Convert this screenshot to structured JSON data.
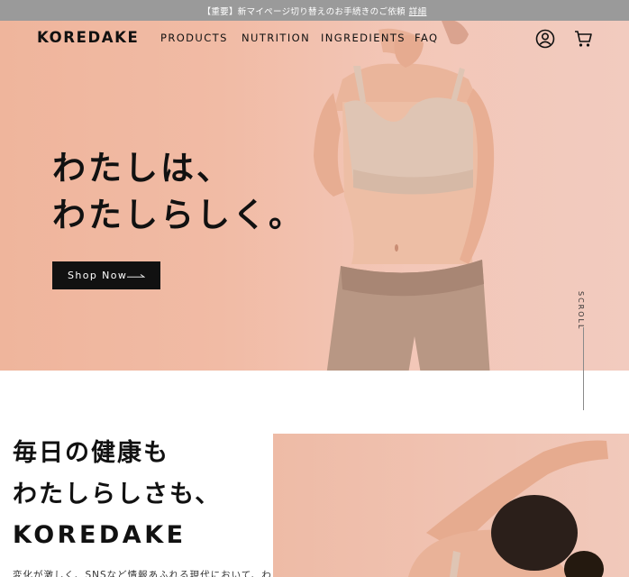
{
  "announcement": {
    "text": "【重要】新マイページ切り替えのお手続きのご依頼",
    "link": "詳細"
  },
  "header": {
    "logo": "KOREDAKE",
    "nav": [
      "PRODUCTS",
      "NUTRITION",
      "INGREDIENTS",
      "FAQ"
    ],
    "icons": [
      "account-icon",
      "cart-icon"
    ]
  },
  "hero": {
    "headline_line1": "わたしは、",
    "headline_line2": "わたしらしく。",
    "cta_label": "Shop Now",
    "scroll_label": "SCROLL",
    "colors": {
      "bg_left": "#efb59c",
      "bg_right": "#f2cbbf",
      "cta_bg": "#111111"
    }
  },
  "section2": {
    "title_line1": "毎日の健康も",
    "title_line2": "わたしらしさも、",
    "title_line3": "KOREDAKE",
    "body": "変化が激しく、SNSなど情報あふれる現代において、わ"
  }
}
